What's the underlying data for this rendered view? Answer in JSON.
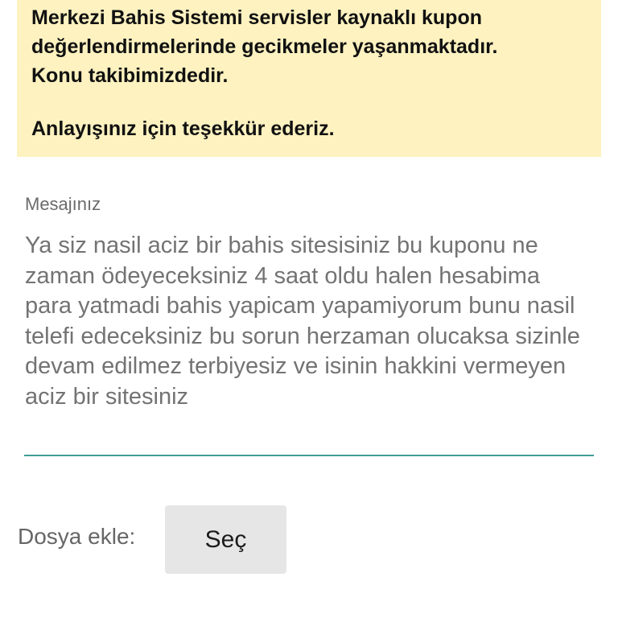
{
  "notice": {
    "line1": "Merkezi Bahis Sistemi servisler kaynaklı kupon",
    "line2": "değerlendirmelerinde gecikmeler yaşanmaktadır.",
    "line3": "Konu takibimizdedir.",
    "line4": "Anlayışınız için teşekkür ederiz.",
    "background_color": "#fdf2c0"
  },
  "message_field": {
    "label": "Mesajınız",
    "value": "Ya siz nasil aciz bir bahis sitesisiniz bu kuponu ne zaman ödeyeceksiniz 4 saat oldu halen hesabima para yatmadi bahis yapicam yapamiyorum bunu nasil telefi edeceksiniz bu sorun herzaman olucaksa sizinle devam edilmez terbiyesiz ve isinin hakkini vermeyen aciz bir sitesiniz",
    "underline_color": "#3f9e97"
  },
  "attachment": {
    "label": "Dosya ekle:",
    "button_label": "Seç"
  }
}
